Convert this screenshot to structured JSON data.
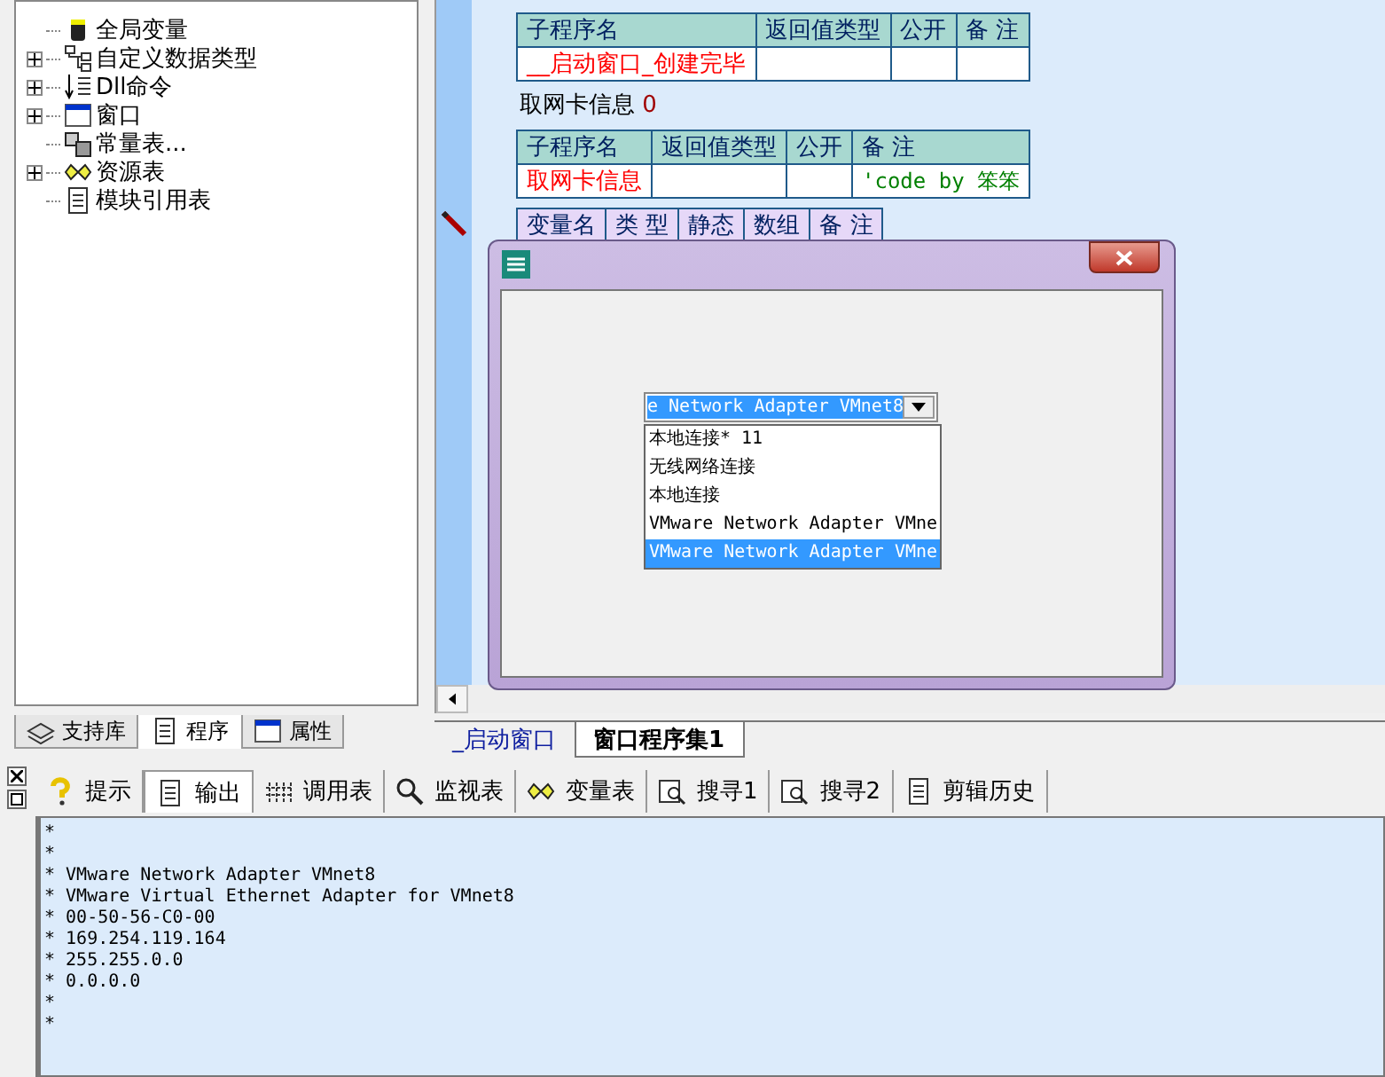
{
  "tree": [
    {
      "label": "全局变量",
      "collapsible": false
    },
    {
      "label": "自定义数据类型",
      "collapsible": true
    },
    {
      "label": "Dll命令",
      "collapsible": true
    },
    {
      "label": "窗口",
      "collapsible": true
    },
    {
      "label": "常量表...",
      "collapsible": false
    },
    {
      "label": "资源表",
      "collapsible": true
    },
    {
      "label": "模块引用表",
      "collapsible": false
    }
  ],
  "left_tabs": [
    {
      "label": "支持库",
      "selected": false
    },
    {
      "label": "程序",
      "selected": true
    },
    {
      "label": "属性",
      "selected": false
    }
  ],
  "code": {
    "sub1": {
      "columns": [
        "子程序名",
        "返回值类型",
        "公开",
        "备 注"
      ],
      "name": "__启动窗口_创建完毕"
    },
    "call": {
      "name": "取网卡信息",
      "arg": "0"
    },
    "sub2": {
      "columns": [
        "子程序名",
        "返回值类型",
        "公开",
        "备 注"
      ],
      "name": "取网卡信息",
      "note": "'code by 笨笨"
    },
    "vars": {
      "columns": [
        "变量名",
        "类 型",
        "静态",
        "数组",
        "备 注"
      ]
    }
  },
  "dialog": {
    "combo_value": "e Network Adapter VMnet8",
    "options": [
      {
        "label": "本地连接* 11",
        "selected": false
      },
      {
        "label": "无线网络连接",
        "selected": false
      },
      {
        "label": "本地连接",
        "selected": false
      },
      {
        "label": "VMware Network Adapter VMne",
        "selected": false
      },
      {
        "label": "VMware Network Adapter VMne",
        "selected": true
      }
    ]
  },
  "editor_tabs": [
    {
      "label": "_启动窗口",
      "selected": false
    },
    {
      "label": "窗口程序集1",
      "selected": true
    }
  ],
  "bottom_tabs": [
    {
      "label": "提示",
      "selected": false
    },
    {
      "label": "输出",
      "selected": true
    },
    {
      "label": "调用表",
      "selected": false
    },
    {
      "label": "监视表",
      "selected": false
    },
    {
      "label": "变量表",
      "selected": false
    },
    {
      "label": "搜寻1",
      "selected": false
    },
    {
      "label": "搜寻2",
      "selected": false
    },
    {
      "label": "剪辑历史",
      "selected": false
    }
  ],
  "output": [
    "*",
    "*",
    "* VMware Network Adapter VMnet8",
    "* VMware Virtual Ethernet Adapter for VMnet8",
    "* 00-50-56-C0-00",
    "* 169.254.119.164",
    "* 255.255.0.0",
    "* 0.0.0.0",
    "*",
    "*"
  ]
}
